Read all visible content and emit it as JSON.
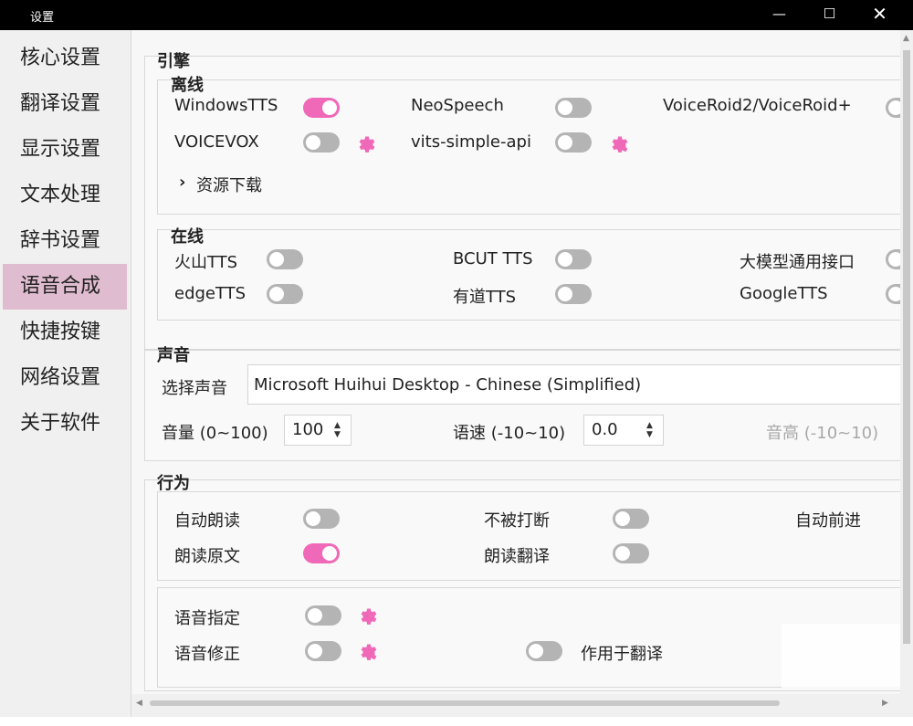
{
  "window": {
    "title": "设置",
    "minimize_icon": "minimize-icon",
    "maximize_icon": "maximize-icon",
    "close_icon": "close-icon"
  },
  "sidebar": {
    "items": [
      "核心设置",
      "翻译设置",
      "显示设置",
      "文本处理",
      "辞书设置",
      "语音合成",
      "快捷按键",
      "网络设置",
      "关于软件"
    ],
    "active_index": 5
  },
  "engine": {
    "title": "引擎",
    "offline": {
      "title": "离线",
      "items": [
        {
          "label": "WindowsTTS",
          "on": true
        },
        {
          "label": "NeoSpeech",
          "on": false
        },
        {
          "label": "VoiceRoid2/VoiceRoid+",
          "on": false
        },
        {
          "label": "VOICEVOX",
          "on": false
        },
        {
          "label": "vits-simple-api",
          "on": false
        }
      ],
      "resource_link": "资源下载"
    },
    "online": {
      "title": "在线",
      "items": [
        {
          "label": "火山TTS",
          "on": false
        },
        {
          "label": "BCUT TTS",
          "on": false
        },
        {
          "label": "大模型通用接口",
          "on": false
        },
        {
          "label": "edgeTTS",
          "on": false
        },
        {
          "label": "有道TTS",
          "on": false
        },
        {
          "label": "GoogleTTS",
          "on": false
        }
      ]
    }
  },
  "voice": {
    "title": "声音",
    "select_label": "选择声音",
    "select_value": "Microsoft Huihui Desktop - Chinese (Simplified)",
    "volume_label": "音量 (0~100)",
    "volume_value": "100",
    "speed_label": "语速 (-10~10)",
    "speed_value": "0.0",
    "pitch_label": "音高 (-10~10)"
  },
  "behavior": {
    "title": "行为",
    "auto_read": {
      "label": "自动朗读",
      "on": false
    },
    "no_interrupt": {
      "label": "不被打断",
      "on": false
    },
    "auto_advance": {
      "label": "自动前进"
    },
    "read_original": {
      "label": "朗读原文",
      "on": true
    },
    "read_translation": {
      "label": "朗读翻译",
      "on": false
    },
    "voice_assign": {
      "label": "语音指定",
      "on": false
    },
    "voice_fix": {
      "label": "语音修正",
      "on": false
    },
    "apply_translation": {
      "label": "作用于翻译",
      "on": false
    }
  },
  "colors": {
    "accent": "#f068b8",
    "toggle_off": "#b4b4b4",
    "active_nav": "#e0bcd0"
  }
}
